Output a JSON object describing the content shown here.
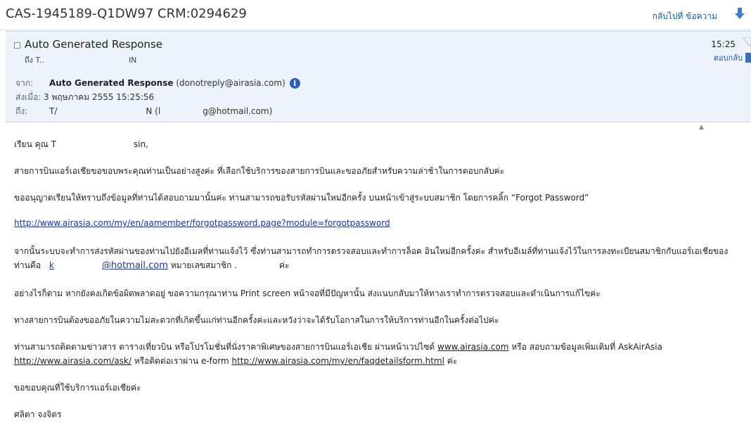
{
  "header": {
    "subject": "CAS-1945189-Q1DW97 CRM:0294629",
    "back_label": "กลับไปที่ ข้อความ"
  },
  "message": {
    "sender_display": "Auto Generated Response",
    "to_short_prefix": "ถึง T..",
    "to_short_suffix": "IN",
    "time": "15:25",
    "reply_label": "ตอบกลับ",
    "from_label": "จาก:",
    "from_name": "Auto Generated Response",
    "from_email": "(donotreply@airasia.com)",
    "sent_label": "ส่งเมื่อ:",
    "sent_value": "3 พฤษภาคม 2555 15:25:56",
    "to_label": "ถึง:",
    "to_prefix": "T/",
    "to_mid": "N (l",
    "to_suffix": "g@hotmail.com)"
  },
  "body": {
    "greeting_a": "เรียน คุณ T",
    "greeting_b": "sin,",
    "p1": "สายการบินแอร์เอเชียขอขอบพระคุณท่านเป็นอย่างสูงค่ะ  ที่เลือกใช้บริการของสายการบินและขออภัยสำหรับความล่าช้าในการตอบกลับค่ะ",
    "p2": "ขออนุญาตเรียนให้ทราบถึงข้อมูลที่ท่านได้สอบถามมานั้นค่ะ ท่านสามารถขอรับรหัสผ่านใหม่อีกครั้ง บนหน้าเข้าสู่ระบบสมาชิก โดยการคลิ้ก “Forgot Password”",
    "link1": "http://www.airasia.com/my/en/aamember/forgotpassword.page?module=forgotpassword",
    "p3": "จากนั้นระบบจะทำการส่งรหัสผ่านของท่านไปยังอีเมลที่ท่านแจ้งไว้ ซึ่งท่านสามารถทำการตรวจสอบและทำการล็อค อินใหม่อีกครั้งค่ะ  สำหรับอีเมล์ที่ท่านแจ้งไว้ในการลงทะเบียนสมาชิกกับแอร์เอเชียของ",
    "p3b_prefix": "ท่านคือ",
    "p3b_email_a": "k",
    "p3b_email_b": "@hotmail.com",
    "p3b_member": "หมายเลขสมาชิก .",
    "p3b_end": "ค่ะ",
    "p4": "อย่างไรก็ตาม หากยังคงเกิดข้อผิดพลาดอยู่ ขอความกรุณาท่าน Print screen หน้าจอที่มีปัญหานั้น ส่งแนบกลับมาให้ทางเราทำการตรวจสอบและดำเนินการแก้ไขค่ะ",
    "p5": "ทางสายการบินต้องขออภัยในความไม่สะดวกที่เกิดขึ้นแก่ท่านอีกครั้งค่ะและหวังว่าจะได้รับโอกาสในการให้บริการท่านอีกในครั้งต่อไปค่ะ",
    "p6a": "ท่านสามารถติดตามข่าวสาร ตารางเที่ยวบิน หรือโปรโมชั่นที่นั่งราคาพิเศษของสายการบินแอร์เอเชีย ผ่านหน้าเวปไซด์",
    "p6_site": "www.airasia.com",
    "p6b": "หรือ สอบถามข้อมูลเพิ่มเติมที่ AskAirAsia",
    "p6_ask": "http://www.airasia.com/ask/",
    "p6c": "หรือติดต่อเราผ่าน e-form",
    "p6_faq": "http://www.airasia.com/my/en/faqdetailsform.html",
    "p6d": "ค่ะ",
    "thanks": "ขอขอบคุณที่ใช้บริการแอร์เอเชียค่ะ",
    "signature": "ศลิตา จงจิตร"
  }
}
